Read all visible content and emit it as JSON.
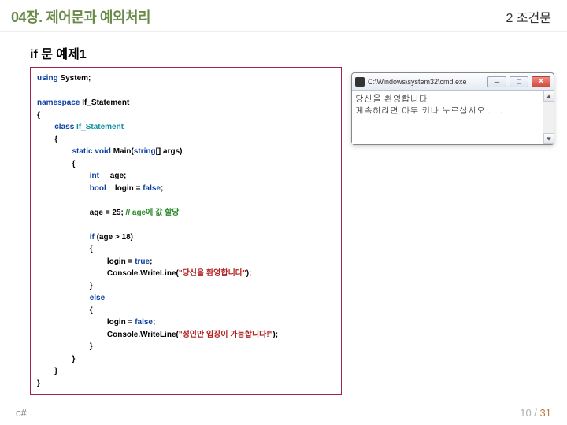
{
  "header": {
    "chapter_title": "04장. 제어문과 예외처리",
    "section_title": "2 조건문"
  },
  "example": {
    "title": "if 문 예제1"
  },
  "code": {
    "line1_using": "using",
    "line1_system": " System;",
    "blank": "",
    "line2_namespace": "namespace",
    "line2_name": " If_Statement",
    "brace_open": "{",
    "line3_indent": "        ",
    "line3_class": "class",
    "line3_name": " If_Statement",
    "line4_indent": "        ",
    "line5_indent": "                ",
    "line5_static_void": "static void",
    "line5_main": " Main(",
    "line5_string": "string",
    "line5_args": "[] args)",
    "line6_indent": "                ",
    "line7_indent": "                        ",
    "line7_int": "int",
    "line7_age": "     age;",
    "line8_indent": "                        ",
    "line8_bool": "bool",
    "line8_login": "    login = ",
    "line8_false": "false",
    "line8_semi": ";",
    "line9_blank": "",
    "line10_indent": "                        ",
    "line10_age": "age = 25; ",
    "line10_cmt": "// age에 값 할당",
    "line11_blank": "",
    "line12_indent": "                        ",
    "line12_if": "if",
    "line12_cond": " (age > 18)",
    "line13_indent": "                        ",
    "line14_indent": "                                ",
    "line14_assign": "login = ",
    "line14_true": "true",
    "line14_semi": ";",
    "line15_indent": "                                ",
    "line15_console": "Console.WriteLine(",
    "line15_str": "\"당신을 환영합니다\"",
    "line15_end": ");",
    "line16_indent": "                        ",
    "brace_close": "}",
    "line17_indent": "                        ",
    "line17_else": "else",
    "line18_indent": "                        ",
    "line19_indent": "                                ",
    "line19_assign": "login = ",
    "line19_false": "false",
    "line19_semi": ";",
    "line20_indent": "                                ",
    "line20_console": "Console.WriteLine(",
    "line20_str": "\"성인만 입장이 가능합니다!\"",
    "line20_end": ");",
    "line21_indent": "                        ",
    "line22_indent": "                ",
    "line23_indent": "        "
  },
  "console": {
    "title": "C:\\Windows\\system32\\cmd.exe",
    "line1": "당신을 환영합니다",
    "line2": "계속하려면 아무 키나 누르십시오 . . ."
  },
  "footer": {
    "left": "c#",
    "page_current": "10",
    "page_sep": " / ",
    "page_total": "31"
  }
}
